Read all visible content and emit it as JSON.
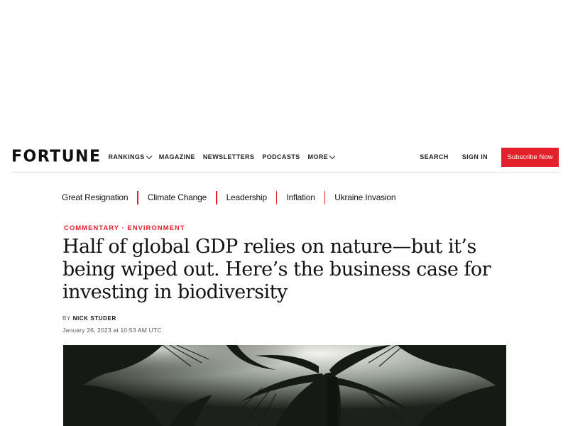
{
  "header": {
    "logo": "FORTUNE",
    "nav": [
      {
        "label": "RANKINGS",
        "dropdown": true
      },
      {
        "label": "MAGAZINE",
        "dropdown": false
      },
      {
        "label": "NEWSLETTERS",
        "dropdown": false
      },
      {
        "label": "PODCASTS",
        "dropdown": false
      },
      {
        "label": "MORE",
        "dropdown": true
      }
    ],
    "search_label": "SEARCH",
    "signin_label": "SIGN IN",
    "subscribe_label": "Subscribe Now"
  },
  "trending": [
    "Great Resignation",
    "Climate Change",
    "Leadership",
    "Inflation",
    "Ukraine Invasion"
  ],
  "article": {
    "category_1": "COMMENTARY",
    "category_sep": "·",
    "category_2": "ENVIRONMENT",
    "headline": "Half of global GDP relies on nature—but it’s being wiped out. Here’s the business case for investing in biodiversity",
    "byline_prefix": "BY",
    "author": "NICK STUDER",
    "date": "January 26, 2023 at 10:53 AM UTC"
  },
  "colors": {
    "accent": "#e4202b",
    "text": "#111111",
    "divider": "#dcdcdc"
  },
  "icons": {
    "dropdown": "chevron-down-icon"
  }
}
